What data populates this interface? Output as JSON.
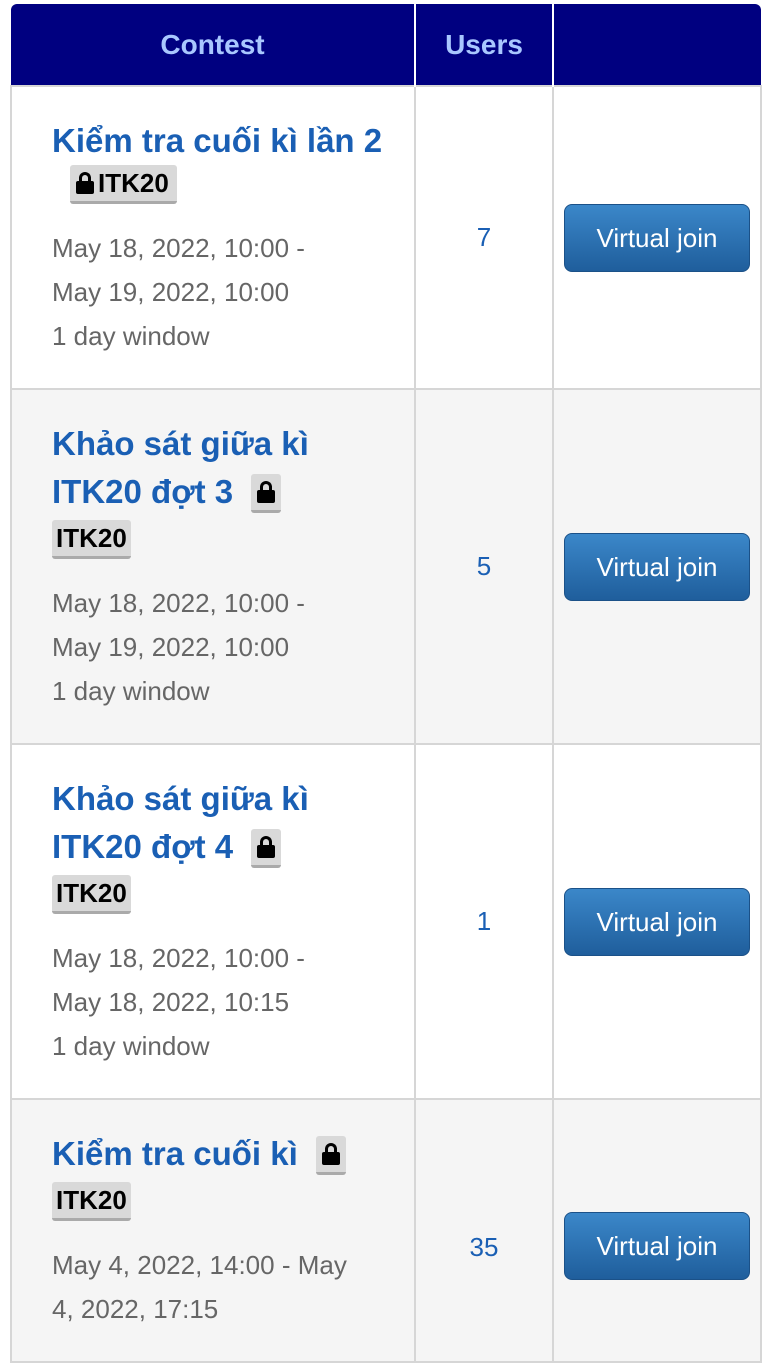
{
  "table": {
    "headers": {
      "contest": "Contest",
      "users": "Users",
      "action": ""
    },
    "rows": [
      {
        "title": "Kiểm tra cuối kì lần 2",
        "org": "ITK20",
        "date_start": "May 18, 2022, 10:00 -",
        "date_end": "May 19, 2022, 10:00",
        "window": "1 day window",
        "users": "7",
        "action_label": "Virtual join"
      },
      {
        "title": "Khảo sát giữa kì ITK20 đợt 3",
        "org": "ITK20",
        "date_start": "May 18, 2022, 10:00 -",
        "date_end": "May 19, 2022, 10:00",
        "window": "1 day window",
        "users": "5",
        "action_label": "Virtual join"
      },
      {
        "title": "Khảo sát giữa kì ITK20 đợt 4",
        "org": "ITK20",
        "date_start": "May 18, 2022, 10:00 -",
        "date_end": "May 18, 2022, 10:15",
        "window": "1 day window",
        "users": "1",
        "action_label": "Virtual join"
      },
      {
        "title": "Kiểm tra cuối kì",
        "org": "ITK20",
        "date_start": "May 4, 2022, 14:00 - May",
        "date_end": "4, 2022, 17:15",
        "users": "35",
        "action_label": "Virtual join"
      }
    ]
  },
  "icons": {
    "lock": "lock-icon"
  },
  "colors": {
    "header_bg": "#000080",
    "header_text": "#a9c7ff",
    "title_link": "#1a5fb4",
    "button_bg": "#2a6fb0"
  }
}
